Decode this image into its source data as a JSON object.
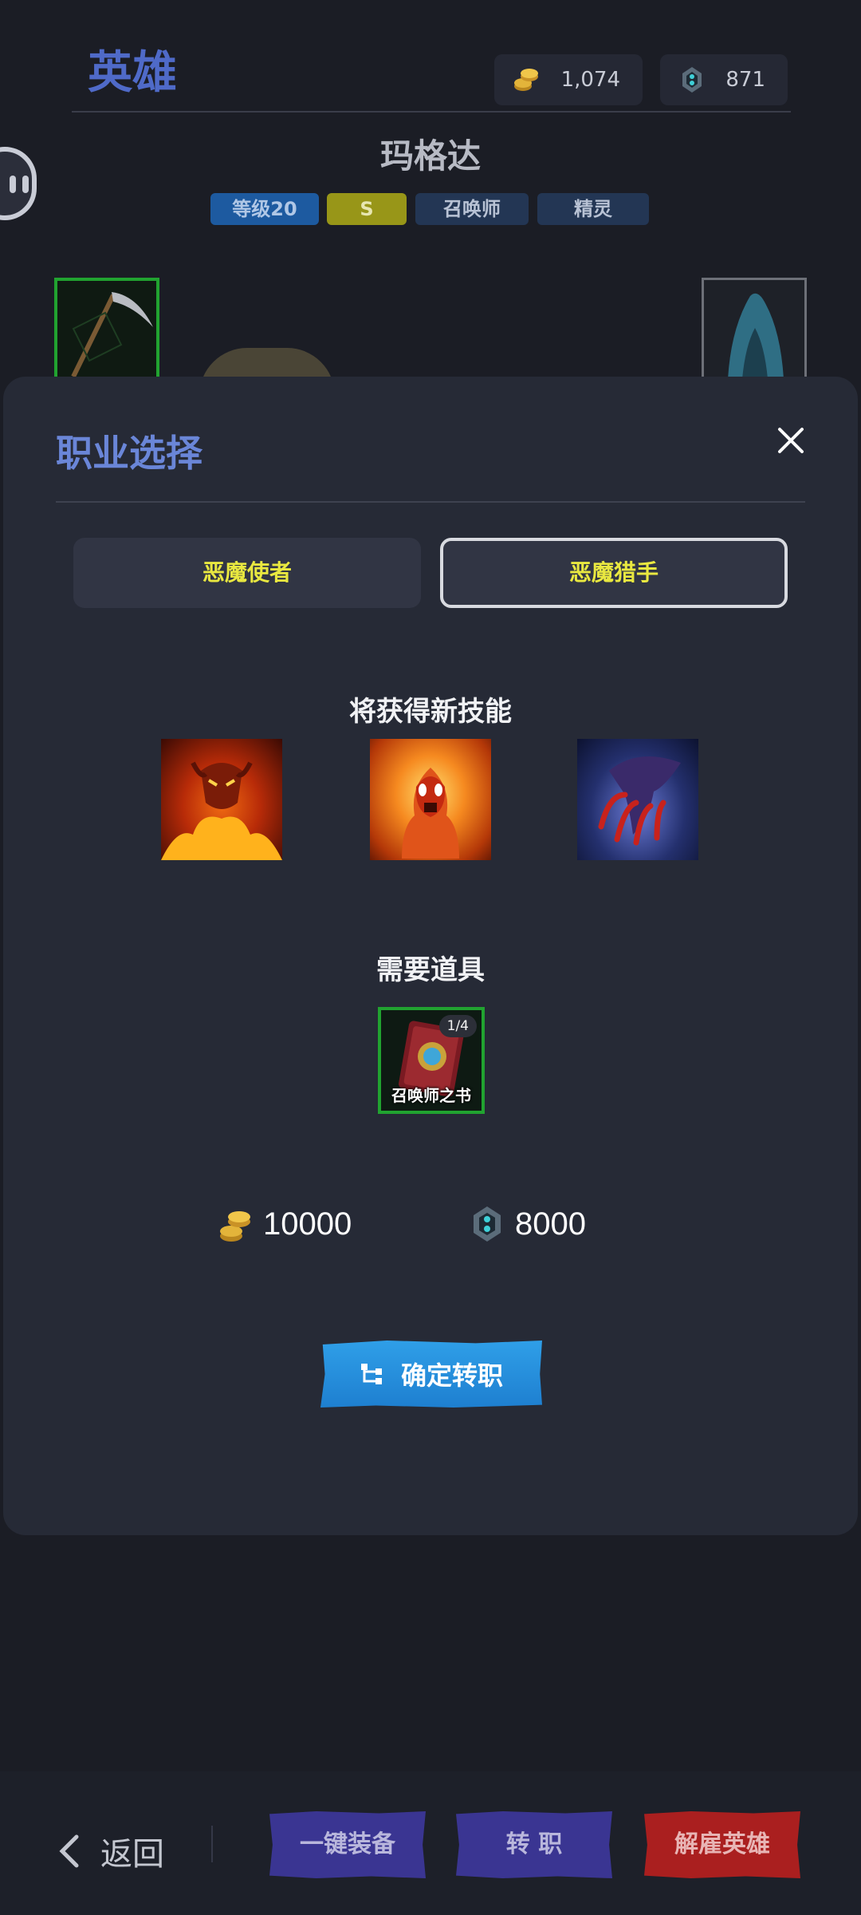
{
  "header": {
    "title": "英雄",
    "gold_amount": "1,074",
    "gem_amount": "871"
  },
  "hero": {
    "name": "玛格达",
    "tags": [
      "等级20",
      "S",
      "召唤师",
      "精灵"
    ]
  },
  "modal": {
    "title": "职业选择",
    "close_icon": "close-icon",
    "options": [
      {
        "label": "恶魔使者",
        "selected": false
      },
      {
        "label": "恶魔猎手",
        "selected": true
      }
    ],
    "skills_label": "将获得新技能",
    "skills": [
      "fire-demon-skill-icon",
      "flame-spirit-skill-icon",
      "demon-claw-skill-icon"
    ],
    "items_label": "需要道具",
    "item": {
      "name": "召唤师之书",
      "count": "1/4"
    },
    "cost": {
      "gold": "10000",
      "gem": "8000"
    },
    "confirm_label": "确定转职"
  },
  "bottom_bar": {
    "back_label": "返回",
    "equip_label": "一键装备",
    "change_label": "转 职",
    "fire_label": "解雇英雄"
  },
  "colors": {
    "background": "#1b1d25",
    "modal": "#262a36",
    "accent_blue": "#6a86d8",
    "option_text": "#e9e840",
    "confirm": "#2f9fe8",
    "purple_button": "#3a3592",
    "red_button": "#aa1f1f"
  }
}
